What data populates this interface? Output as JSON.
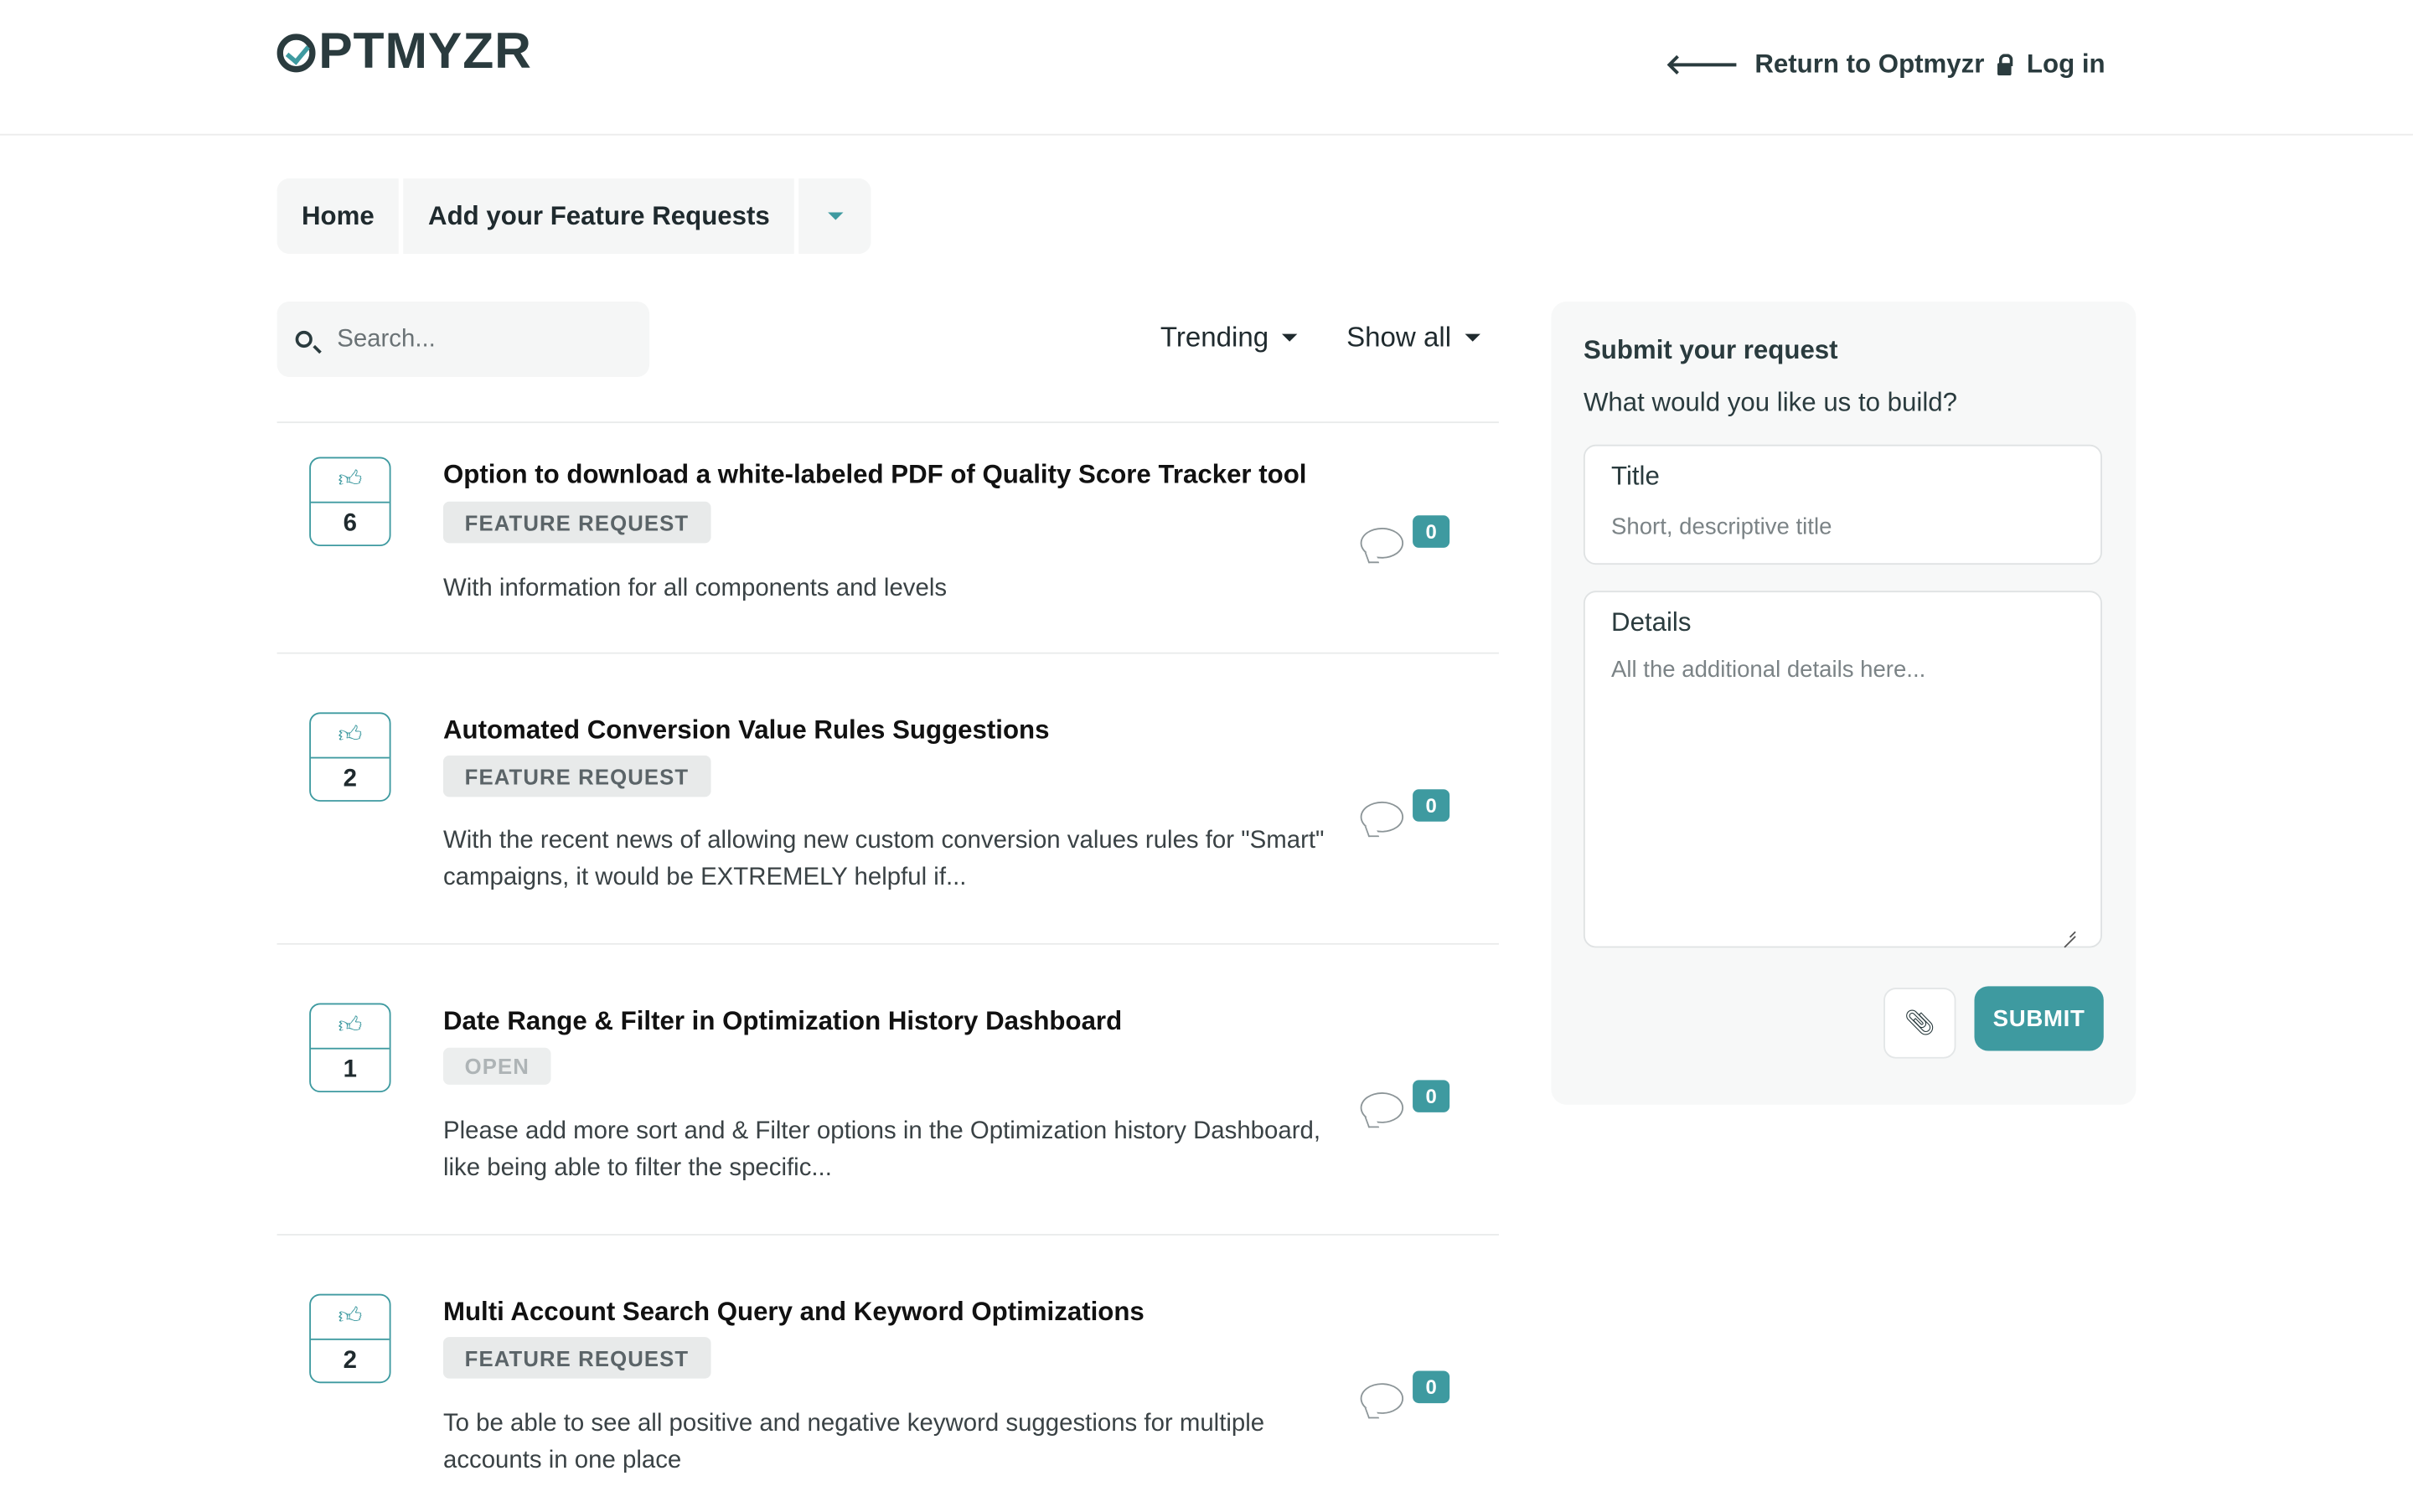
{
  "header": {
    "logo_text": "PTMYZR",
    "return_label": "Return to Optmyzr",
    "login_label": "Log in"
  },
  "breadcrumb": {
    "home": "Home",
    "current": "Add your Feature Requests"
  },
  "search": {
    "placeholder": "Search..."
  },
  "filters": {
    "sort": "Trending",
    "show": "Show all"
  },
  "requests": [
    {
      "votes": "6",
      "title": "Option to download a white-labeled PDF of Quality Score Tracker tool",
      "status": "FEATURE REQUEST",
      "description": "With information for all components and levels",
      "comments": "0"
    },
    {
      "votes": "2",
      "title": "Automated Conversion Value Rules Suggestions",
      "status": "FEATURE REQUEST",
      "description": "With the recent news of allowing new custom conversion values rules for \"Smart\" campaigns, it would be EXTREMELY helpful if...",
      "comments": "0"
    },
    {
      "votes": "1",
      "title": "Date Range & Filter in Optimization History Dashboard",
      "status": "OPEN",
      "description": "Please add more sort and & Filter options in the Optimization history Dashboard, like being able to filter the specific...",
      "comments": "0"
    },
    {
      "votes": "2",
      "title": "Multi Account Search Query and Keyword Optimizations",
      "status": "FEATURE REQUEST",
      "description": "To be able to see all positive and negative keyword suggestions for multiple accounts in one place",
      "comments": "0"
    }
  ],
  "panel": {
    "heading": "Submit your request",
    "subheading": "What would you like us to build?",
    "title_label": "Title",
    "title_placeholder": "Short, descriptive title",
    "details_label": "Details",
    "details_placeholder": "All the additional details here...",
    "submit_label": "SUBMIT"
  },
  "icons": {
    "return": "arrow-left-icon",
    "login": "lock-icon",
    "search": "search-icon",
    "upvote": "thumbs-up-icon",
    "comment": "speech-bubble-icon",
    "attach": "paperclip-icon"
  },
  "colors": {
    "accent": "#3e9aa0",
    "text": "#1f2a2e",
    "badge_bg": "#e8eaea"
  }
}
